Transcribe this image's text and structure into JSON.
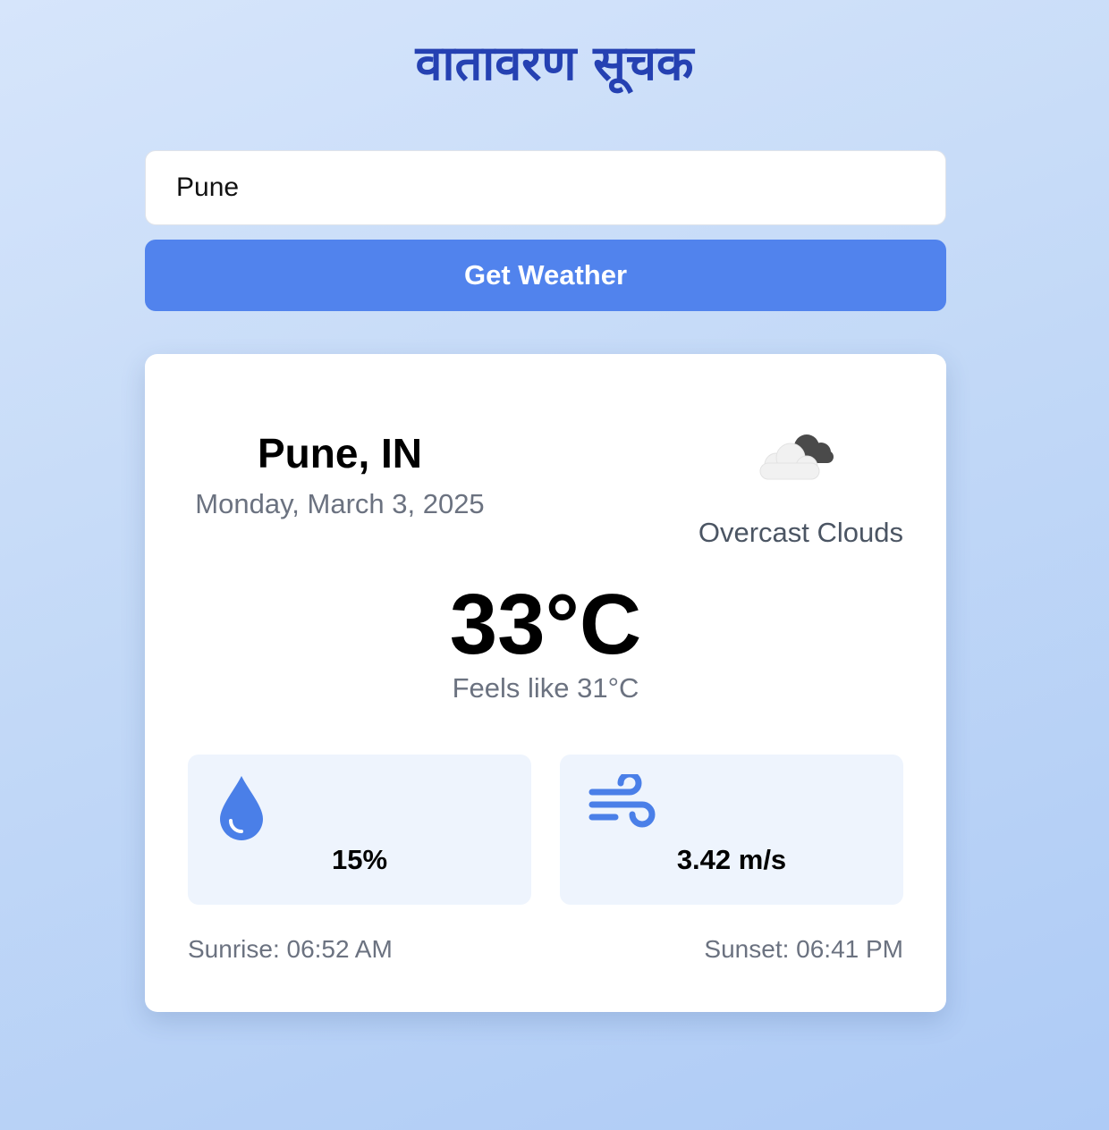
{
  "app": {
    "title": "वातावरण सूचक"
  },
  "search": {
    "value": "Pune",
    "button_label": "Get Weather"
  },
  "weather": {
    "location": "Pune, IN",
    "date": "Monday, March 3, 2025",
    "icon": "overcast-cloud-icon",
    "condition": "Overcast Clouds",
    "temperature": "33°C",
    "feels_like": "Feels like 31°C",
    "humidity": {
      "icon": "water-drop-icon",
      "value": "15%"
    },
    "wind": {
      "icon": "wind-icon",
      "value": "3.42 m/s"
    },
    "sunrise": "Sunrise: 06:52 AM",
    "sunset": "Sunset: 06:41 PM"
  },
  "colors": {
    "title": "#2541b2",
    "button": "#5183ed",
    "accent_icon": "#4a7fe8",
    "stat_bg": "#eef4fd"
  }
}
